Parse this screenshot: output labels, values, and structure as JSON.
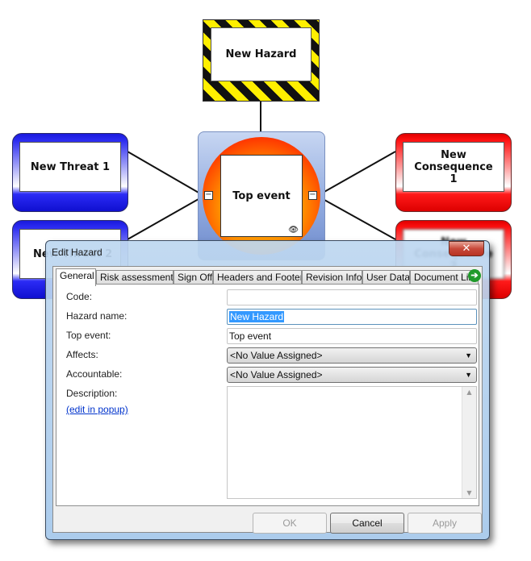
{
  "diagram": {
    "hazard": {
      "label": "New Hazard"
    },
    "top_event": {
      "label": "Top event",
      "eye_icon": "👁"
    },
    "threats": [
      {
        "label": "New Threat 1"
      },
      {
        "label": "New Threat 2"
      }
    ],
    "consequences": [
      {
        "label": "New Consequence 1"
      },
      {
        "label": "New Consequence 2"
      }
    ],
    "collapse_glyph": "−",
    "colors": {
      "threat": "#1a1adc",
      "consequence": "#ff0000",
      "hazard_stripe": "#ffef00",
      "top_event_fill": "#ff9000"
    }
  },
  "dialog": {
    "title": "Edit Hazard",
    "close_glyph": "✕",
    "tabs": [
      {
        "label": "General",
        "active": true
      },
      {
        "label": "Risk assessments"
      },
      {
        "label": "Sign Off"
      },
      {
        "label": "Headers and Footers"
      },
      {
        "label": "Revision Info"
      },
      {
        "label": "User Data"
      },
      {
        "label": "Document Link"
      }
    ],
    "tab_scroll_glyph": "➔",
    "form": {
      "code": {
        "label": "Code:",
        "value": ""
      },
      "hazard_name": {
        "label": "Hazard name:",
        "value": "New Hazard"
      },
      "top_event": {
        "label": "Top event:",
        "value": "Top event"
      },
      "affects": {
        "label": "Affects:",
        "value": "<No Value Assigned>"
      },
      "accountable": {
        "label": "Accountable:",
        "value": "<No Value Assigned>"
      },
      "description": {
        "label": "Description:",
        "value": "",
        "edit_link": "(edit in popup)"
      }
    },
    "buttons": {
      "ok": "OK",
      "cancel": "Cancel",
      "apply": "Apply"
    }
  }
}
